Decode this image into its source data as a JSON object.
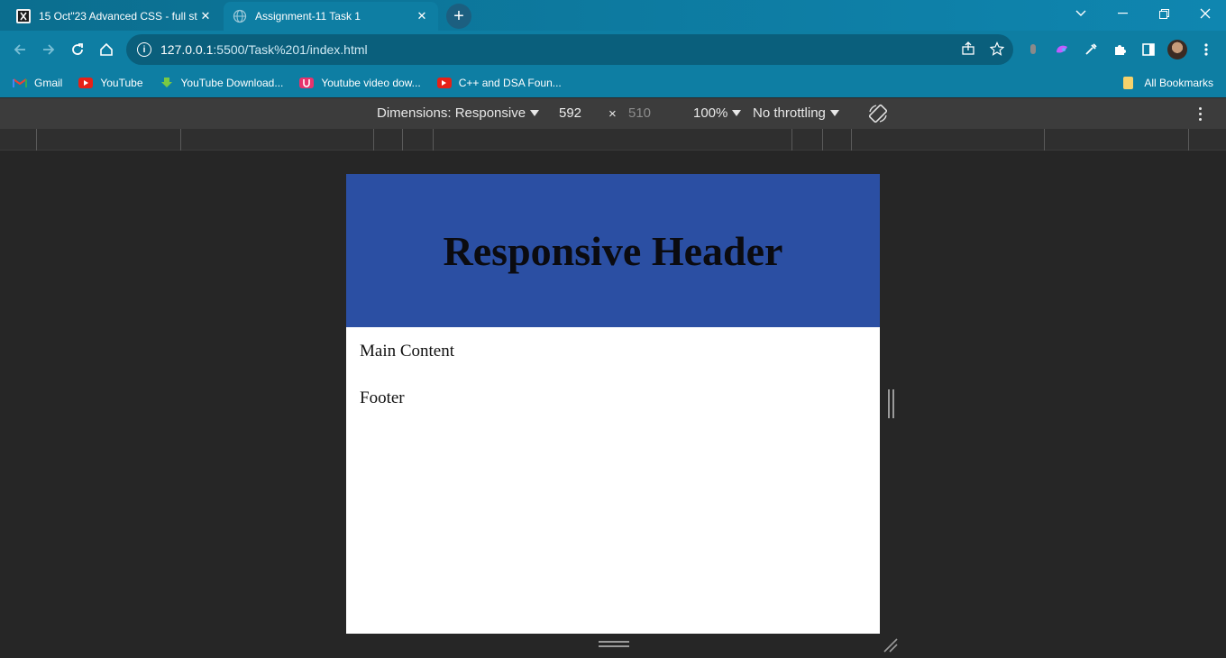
{
  "tabs": [
    {
      "title": "15 Oct\"23 Advanced CSS - full st",
      "active": false
    },
    {
      "title": "Assignment-11 Task 1",
      "active": true
    }
  ],
  "address": {
    "host": "127.0.0.1",
    "path": ":5500/Task%201/index.html"
  },
  "bookmarks": [
    {
      "label": "Gmail",
      "icon": "gmail-icon"
    },
    {
      "label": "YouTube",
      "icon": "youtube-icon"
    },
    {
      "label": "YouTube Download...",
      "icon": "download-icon"
    },
    {
      "label": "Youtube video dow...",
      "icon": "u-icon"
    },
    {
      "label": "C++ and DSA Foun...",
      "icon": "youtube-icon"
    }
  ],
  "all_bookmarks": "All Bookmarks",
  "devtools": {
    "dimensions_label": "Dimensions: Responsive",
    "width": "592",
    "times": "×",
    "height": "510",
    "zoom": "100%",
    "throttling": "No throttling"
  },
  "page": {
    "header": "Responsive Header",
    "main": "Main Content",
    "footer": "Footer"
  },
  "colors": {
    "chrome": "#0e7ea3",
    "header_bg": "#2b4fa3",
    "dev_bg": "#262626"
  }
}
